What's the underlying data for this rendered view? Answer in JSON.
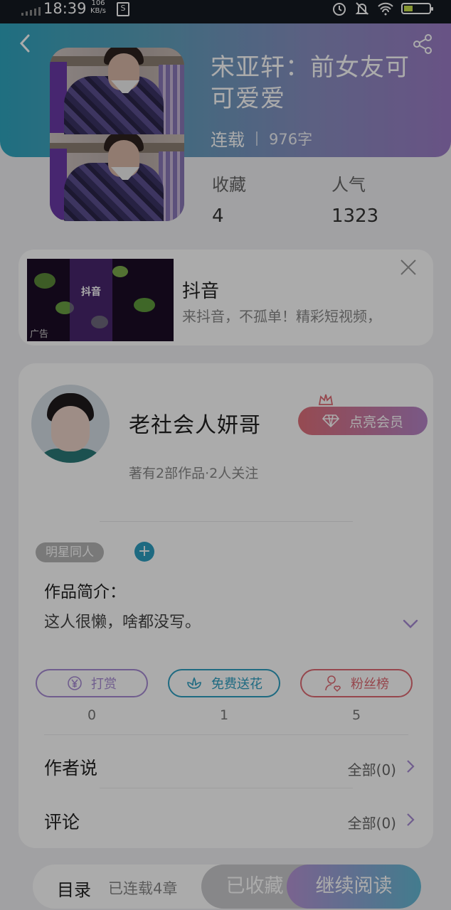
{
  "status_bar": {
    "time": "18:39",
    "net_speed_value": "106",
    "net_speed_unit": "KB/s",
    "battery_level": 0.35
  },
  "book": {
    "title": "宋亚轩：前女友可可爱爱",
    "status": "连载",
    "word_count": "976字",
    "favorites_label": "收藏",
    "favorites_value": "4",
    "popularity_label": "人气",
    "popularity_value": "1323"
  },
  "ad": {
    "title": "抖音",
    "description": "来抖音，不孤单！精彩短视频，",
    "logo_text": "抖音",
    "tag": "广告"
  },
  "author": {
    "name": "老社会人妍哥",
    "meta": "著有2部作品·2人关注",
    "vip_label": "点亮会员"
  },
  "tags": {
    "category": "明星同人"
  },
  "intro": {
    "label": "作品简介：",
    "text": "这人很懒，啥都没写。"
  },
  "actions": {
    "tip_label": "打赏",
    "tip_count": "0",
    "flower_label": "免费送花",
    "flower_count": "1",
    "fans_label": "粉丝榜",
    "fans_count": "5"
  },
  "sections": {
    "author_says": "作者说",
    "author_says_all": "全部(0)",
    "comments": "评论",
    "comments_all": "全部(0)"
  },
  "bottom_bar": {
    "toc_label": "目录",
    "toc_count": "已连载4章",
    "favorited_label": "已收藏",
    "continue_label": "继续阅读"
  },
  "colors": {
    "header_start": "#2fa6bf",
    "header_end": "#9c7cc6",
    "accent_blue": "#2e9fc1",
    "accent_purple": "#a78bd4",
    "accent_red": "#e06a74"
  }
}
